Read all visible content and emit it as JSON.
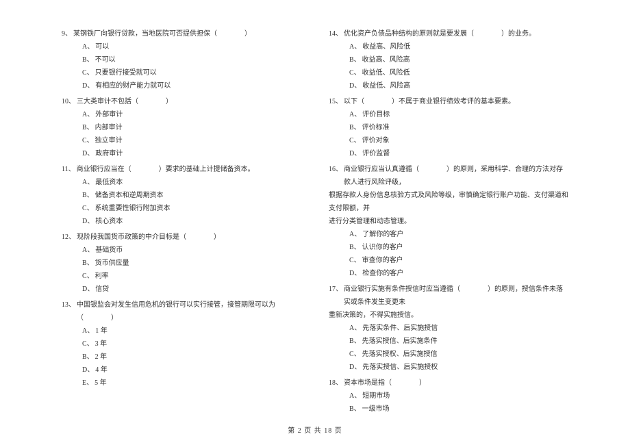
{
  "footer": "第 2 页 共 18 页",
  "left_column": [
    {
      "num": "9、",
      "text": "某钢铁厂向银行贷款，当地医院可否提供担保（　　　　）",
      "options": [
        {
          "label": "A、",
          "text": "可以"
        },
        {
          "label": "B、",
          "text": "不可以"
        },
        {
          "label": "C、",
          "text": "只要银行接受就可以"
        },
        {
          "label": "D、",
          "text": "有相应的财产能力就可以"
        }
      ]
    },
    {
      "num": "10、",
      "text": "三大类审计不包括（　　　　）",
      "options": [
        {
          "label": "A、",
          "text": "外部审计"
        },
        {
          "label": "B、",
          "text": "内部审计"
        },
        {
          "label": "C、",
          "text": "独立审计"
        },
        {
          "label": "D、",
          "text": "政府审计"
        }
      ]
    },
    {
      "num": "11、",
      "text": "商业银行应当在（　　　　）要求的基础上计提储备资本。",
      "options": [
        {
          "label": "A、",
          "text": "最低资本"
        },
        {
          "label": "B、",
          "text": "储备资本和逆周期资本"
        },
        {
          "label": "C、",
          "text": "系统重要性银行附加资本"
        },
        {
          "label": "D、",
          "text": "核心资本"
        }
      ]
    },
    {
      "num": "12、",
      "text": "现阶段我国货币政策的中介目标是（　　　　）",
      "options": [
        {
          "label": "A、",
          "text": "基础货币"
        },
        {
          "label": "B、",
          "text": "货币供应量"
        },
        {
          "label": "C、",
          "text": "利率"
        },
        {
          "label": "D、",
          "text": "信贷"
        }
      ]
    },
    {
      "num": "13、",
      "text": "中国银监会对发生信用危机的银行可以实行接管，接管期限可以为（　　　　）",
      "options": [
        {
          "label": "A、",
          "text": "1 年"
        },
        {
          "label": "C、",
          "text": "3 年"
        },
        {
          "label": "B、",
          "text": "2 年"
        },
        {
          "label": "D、",
          "text": "4 年"
        },
        {
          "label": "E、",
          "text": "5 年"
        }
      ]
    }
  ],
  "right_column": [
    {
      "num": "14、",
      "text": "优化资产负债品种结构的原则就是要发展（　　　　）的业务。",
      "options": [
        {
          "label": "A、",
          "text": "收益高、风险低"
        },
        {
          "label": "B、",
          "text": "收益高、风险高"
        },
        {
          "label": "C、",
          "text": "收益低、风险低"
        },
        {
          "label": "D、",
          "text": "收益低、风险高"
        }
      ]
    },
    {
      "num": "15、",
      "text": "以下（　　　　）不属于商业银行绩效考评的基本要素。",
      "options": [
        {
          "label": "A、",
          "text": "评价目标"
        },
        {
          "label": "B、",
          "text": "评价标准"
        },
        {
          "label": "C、",
          "text": "评价对象"
        },
        {
          "label": "D、",
          "text": "评价监督"
        }
      ]
    },
    {
      "num": "16、",
      "text": "商业银行应当认真遵循（　　　　）的原则，采用科学、合理的方法对存款人进行风险评级，",
      "continuation": [
        "根据存款人身份信息核验方式及风险等级，审慎确定银行账户功能、支付渠道和支付限额，并",
        "进行分类管理和动态管理。"
      ],
      "options": [
        {
          "label": "A、",
          "text": "了解你的客户"
        },
        {
          "label": "B、",
          "text": "认识你的客户"
        },
        {
          "label": "C、",
          "text": "审查你的客户"
        },
        {
          "label": "D、",
          "text": "检查你的客户"
        }
      ]
    },
    {
      "num": "17、",
      "text": "商业银行实施有条件授信时应当遵循（　　　　）的原则，授信条件未落实或条件发生变更未",
      "continuation": [
        "重新决策的，不得实施授信。"
      ],
      "options": [
        {
          "label": "A、",
          "text": "先落实条件、后实施授信"
        },
        {
          "label": "B、",
          "text": "先落实授信、后实施条件"
        },
        {
          "label": "C、",
          "text": "先落实授权、后实施授信"
        },
        {
          "label": "D、",
          "text": "先落实授信、后实施授权"
        }
      ]
    },
    {
      "num": "18、",
      "text": "资本市场是指（　　　　）",
      "options": [
        {
          "label": "A、",
          "text": "短期市场"
        },
        {
          "label": "B、",
          "text": "一级市场"
        }
      ]
    }
  ]
}
